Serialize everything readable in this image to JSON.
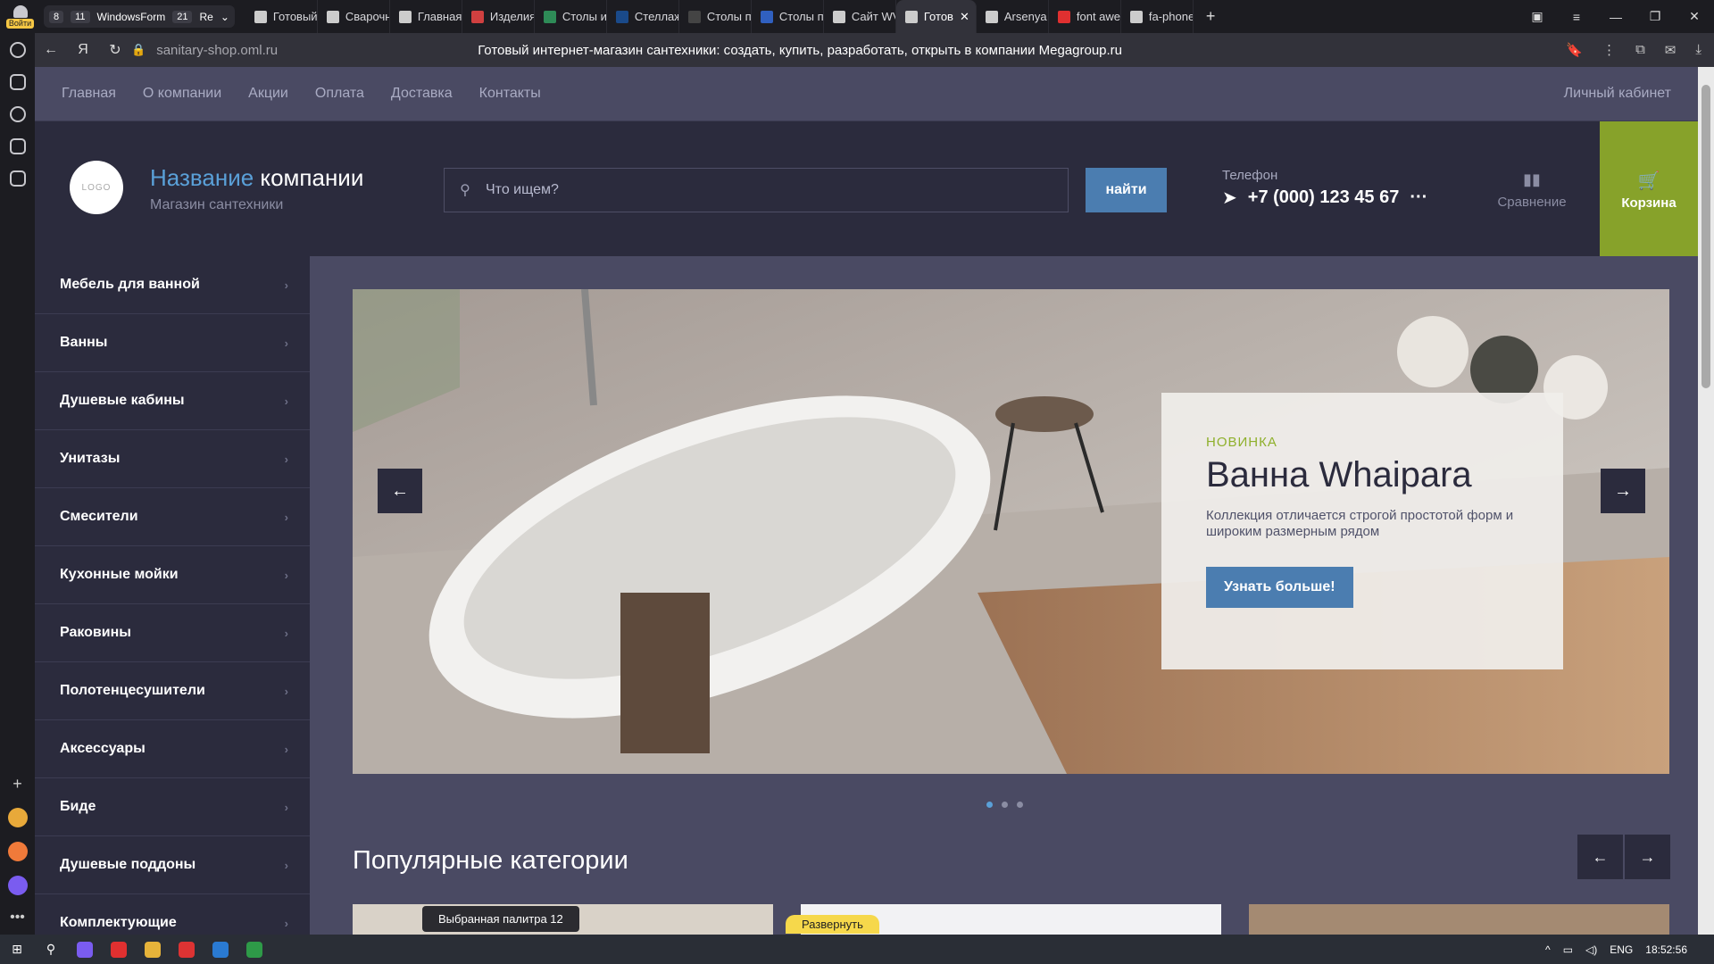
{
  "browser": {
    "login_badge": "Войти",
    "tab_group": {
      "count1": "8",
      "count2": "11",
      "label": "WindowsForm",
      "count3": "21",
      "more": "Re"
    },
    "tabs": [
      {
        "label": "Готовый",
        "color": "#cccccc"
      },
      {
        "label": "Сварочн",
        "color": "#cccccc"
      },
      {
        "label": "Главная",
        "color": "#cccccc"
      },
      {
        "label": "Изделия",
        "color": "#d04040"
      },
      {
        "label": "Столы и",
        "color": "#2e8b57"
      },
      {
        "label": "Стеллаж",
        "color": "#1a4a8a"
      },
      {
        "label": "Столы пр",
        "color": "#444444"
      },
      {
        "label": "Столы пр",
        "color": "#3060c0"
      },
      {
        "label": "Сайт WV",
        "color": "#cccccc"
      },
      {
        "label": "Готов",
        "color": "#cccccc",
        "active": true
      },
      {
        "label": "Arsenya",
        "color": "#cccccc"
      },
      {
        "label": "font awe",
        "color": "#e03030"
      },
      {
        "label": "fa-phone",
        "color": "#cccccc"
      }
    ],
    "url": "sanitary-shop.oml.ru",
    "page_title": "Готовый интернет-магазин сантехники: создать, купить, разработать, открыть в компании Megagroup.ru"
  },
  "nav": {
    "items": [
      "Главная",
      "О компании",
      "Акции",
      "Оплата",
      "Доставка",
      "Контакты"
    ],
    "cabinet": "Личный кабинет"
  },
  "header": {
    "logo_text": "LOGO",
    "brand_highlight": "Название",
    "brand_rest": " компании",
    "subtitle": "Магазин сантехники",
    "search_placeholder": "Что ищем?",
    "search_button": "найти",
    "phone_label": "Телефон",
    "phone_number": "+7 (000) 123 45 67",
    "compare": "Сравнение",
    "cart": "Корзина"
  },
  "categories": [
    "Мебель для ванной",
    "Ванны",
    "Душевые кабины",
    "Унитазы",
    "Смесители",
    "Кухонные мойки",
    "Раковины",
    "Полотенцесушители",
    "Аксессуары",
    "Биде",
    "Душевые поддоны",
    "Комплектующие"
  ],
  "hero": {
    "tag": "НОВИНКА",
    "title": "Ванна Whaipara",
    "description": "Коллекция отличается строгой простотой форм и широким размерным рядом",
    "button": "Узнать больше!"
  },
  "popular": {
    "title": "Популярные категории"
  },
  "overlays": {
    "tooltip": "Выбранная палитра 12",
    "expand": "Развернуть"
  },
  "taskbar": {
    "lang": "ENG",
    "time": "18:52:56"
  },
  "colors": {
    "accent": "#4b7db0",
    "cart": "#87a22a",
    "header_bg": "#2b2b3d",
    "site_bg": "#4a4a63"
  }
}
